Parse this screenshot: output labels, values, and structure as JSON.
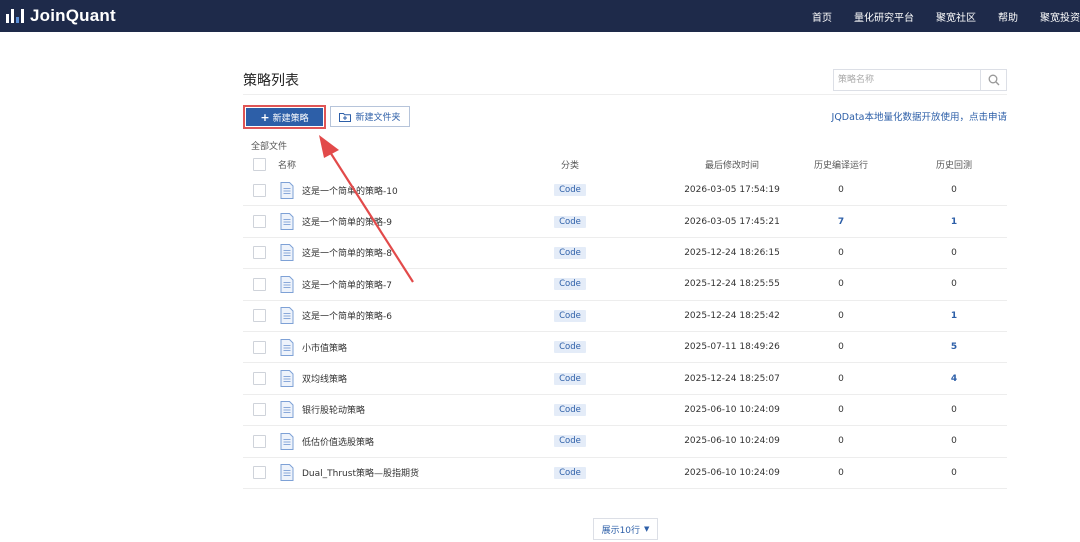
{
  "app": {
    "logo_text": "JoinQuant"
  },
  "nav": {
    "items": [
      "首页",
      "量化研究平台",
      "聚宽社区",
      "帮助",
      "聚宽投资"
    ]
  },
  "page": {
    "title": "策略列表"
  },
  "search": {
    "placeholder": "策略名称",
    "icon": "search-icon"
  },
  "toolbar": {
    "new_strategy_label": "新建策略",
    "new_folder_label": "新建文件夹",
    "promo_text": "JQData本地量化数据开放使用，点击申请"
  },
  "folder": {
    "label": "全部文件"
  },
  "table": {
    "headers": {
      "name": "名称",
      "category": "分类",
      "modified": "最后修改时间",
      "runs": "历史编译运行",
      "backtests": "历史回测"
    },
    "rows": [
      {
        "name": "这是一个简单的策略-10",
        "category": "Code",
        "modified": "2026-03-05 17:54:19",
        "runs": "0",
        "backtests": "0"
      },
      {
        "name": "这是一个简单的策略-9",
        "category": "Code",
        "modified": "2026-03-05 17:45:21",
        "runs": "7",
        "backtests": "1"
      },
      {
        "name": "这是一个简单的策略-8",
        "category": "Code",
        "modified": "2025-12-24 18:26:15",
        "runs": "0",
        "backtests": "0"
      },
      {
        "name": "这是一个简单的策略-7",
        "category": "Code",
        "modified": "2025-12-24 18:25:55",
        "runs": "0",
        "backtests": "0"
      },
      {
        "name": "这是一个简单的策略-6",
        "category": "Code",
        "modified": "2025-12-24 18:25:42",
        "runs": "0",
        "backtests": "1"
      },
      {
        "name": "小市值策略",
        "category": "Code",
        "modified": "2025-07-11 18:49:26",
        "runs": "0",
        "backtests": "5"
      },
      {
        "name": "双均线策略",
        "category": "Code",
        "modified": "2025-12-24 18:25:07",
        "runs": "0",
        "backtests": "4"
      },
      {
        "name": "银行股轮动策略",
        "category": "Code",
        "modified": "2025-06-10 10:24:09",
        "runs": "0",
        "backtests": "0"
      },
      {
        "name": "低估价值选股策略",
        "category": "Code",
        "modified": "2025-06-10 10:24:09",
        "runs": "0",
        "backtests": "0"
      },
      {
        "name": "Dual_Thrust策略—股指期货",
        "category": "Code",
        "modified": "2025-06-10 10:24:09",
        "runs": "0",
        "backtests": "0"
      }
    ]
  },
  "pager": {
    "label": "展示10行"
  },
  "colors": {
    "nav_bg": "#1e2a4a",
    "accent": "#2d5fa8",
    "highlight_border": "#e05555",
    "annotation_arrow": "#e24a4a"
  }
}
